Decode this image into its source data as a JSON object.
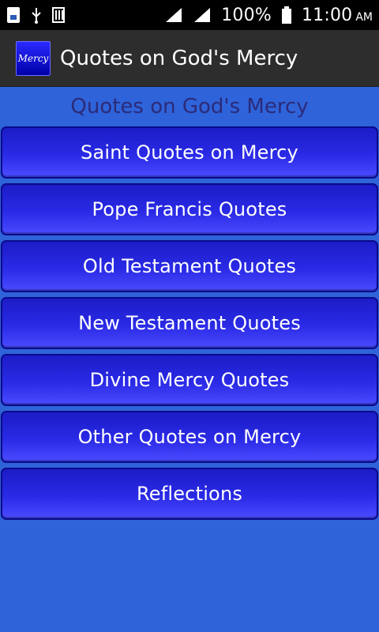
{
  "status_bar": {
    "battery_percent": "100%",
    "time": "11:00",
    "ampm": "AM",
    "icons": [
      "sim-card-icon",
      "usb-icon",
      "storage-icon",
      "signal-icon",
      "signal-icon-2",
      "battery-icon"
    ]
  },
  "action_bar": {
    "app_icon_label": "Mercy",
    "title": "Quotes on God's Mercy"
  },
  "page": {
    "title": "Quotes on God's Mercy"
  },
  "menu": {
    "items": [
      {
        "label": "Saint Quotes on Mercy"
      },
      {
        "label": "Pope Francis Quotes"
      },
      {
        "label": "Old Testament Quotes"
      },
      {
        "label": "New Testament Quotes"
      },
      {
        "label": "Divine Mercy Quotes"
      },
      {
        "label": "Other Quotes on Mercy"
      },
      {
        "label": "Reflections"
      }
    ]
  },
  "colors": {
    "background": "#2f63d9",
    "button": "#2a2ae6",
    "title_text": "#2b2b7a"
  }
}
